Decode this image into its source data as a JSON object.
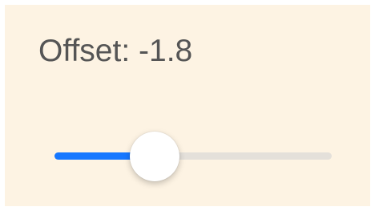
{
  "offset": {
    "label": "Offset:",
    "value_text": "-1.8",
    "slider_fraction": 0.36,
    "accent_color": "#1677ff",
    "track_color": "#e4e0da"
  }
}
